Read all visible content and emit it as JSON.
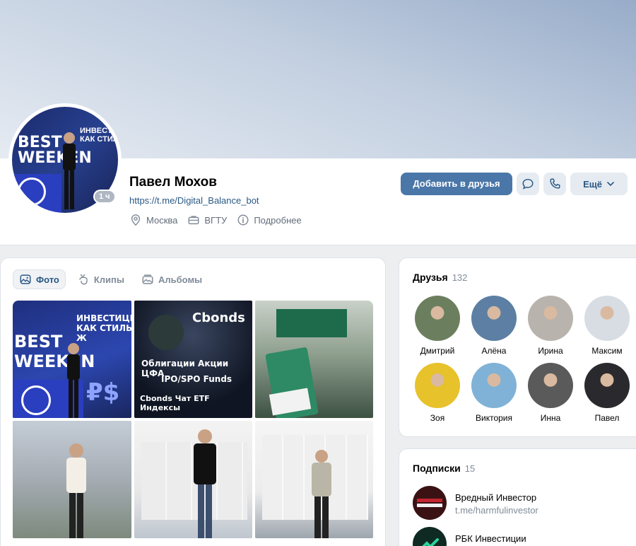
{
  "profile": {
    "name": "Павел Мохов",
    "link": "https://t.me/Digital_Balance_bot",
    "city": "Москва",
    "education": "ВГТУ",
    "details": "Подробнее",
    "online_badge": "1 ч",
    "avatar_text_1": "BEST",
    "avatar_text_2": "WEEKEN",
    "avatar_text_3": "ИНВЕСТИЦИИ КАК СТИЛЬ"
  },
  "actions": {
    "add_friend": "Добавить в друзья",
    "more": "Ещё"
  },
  "photos": {
    "tabs": [
      {
        "label": "Фото",
        "icon": "photo-icon",
        "active": true
      },
      {
        "label": "Клипы",
        "icon": "clips-icon",
        "active": false
      },
      {
        "label": "Альбомы",
        "icon": "albums-icon",
        "active": false
      }
    ],
    "captions": {
      "p1_a": "ИНВЕСТИЦИИ",
      "p1_b": "КАК СТИЛЬ Ж",
      "p1_c": "BEST",
      "p1_d": "WEEKEN",
      "p2_a": "Cbonds",
      "p2_b": "Облигации Акции ЦФА",
      "p2_c": "IPO/SPO Funds",
      "p2_d": "Cbonds Чат ETF Индексы"
    }
  },
  "friends": {
    "title": "Друзья",
    "count": "132",
    "items": [
      {
        "name": "Дмитрий",
        "color": "#6b7f5e"
      },
      {
        "name": "Алёна",
        "color": "#5c7fa3"
      },
      {
        "name": "Ирина",
        "color": "#b9b3ad"
      },
      {
        "name": "Максим",
        "color": "#d7dde3"
      },
      {
        "name": "Зоя",
        "color": "#e7c22a"
      },
      {
        "name": "Виктория",
        "color": "#7fb2d6"
      },
      {
        "name": "Инна",
        "color": "#5a5a5a"
      },
      {
        "name": "Павел",
        "color": "#2a2a2e"
      }
    ]
  },
  "subscriptions": {
    "title": "Подписки",
    "count": "15",
    "items": [
      {
        "name": "Вредный Инвестор",
        "link": "t.me/harmfulinvestor",
        "color": "#3a1214"
      },
      {
        "name": "РБК Инвестиции",
        "link": "",
        "color": "#0e2a22"
      }
    ]
  }
}
